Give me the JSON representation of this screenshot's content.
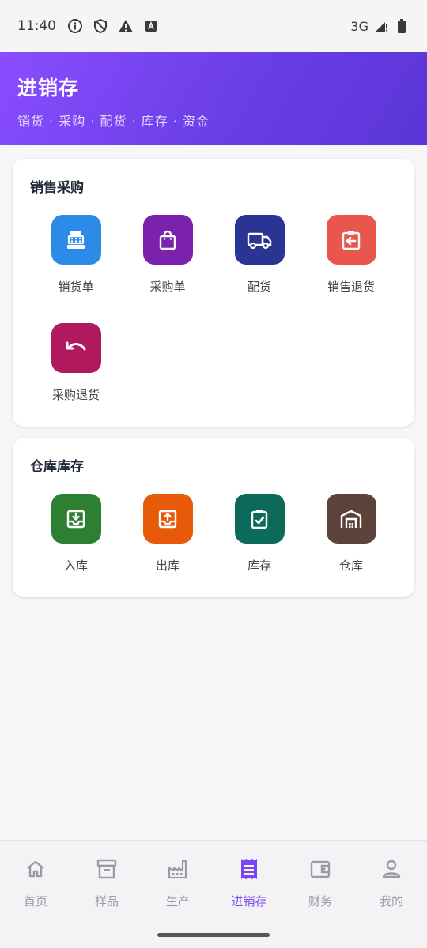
{
  "status_bar": {
    "time": "11:40",
    "network": "3G",
    "icons": [
      "info-icon",
      "shield-icon",
      "warning-icon",
      "font-icon",
      "signal-icon",
      "battery-icon"
    ]
  },
  "header": {
    "title": "进销存",
    "subtitle": "销货 · 采购 · 配货 · 库存 · 资金"
  },
  "sections": [
    {
      "title": "销售采购",
      "items": [
        {
          "label": "销货单",
          "icon": "cash-register-icon",
          "color": "#2b8be6"
        },
        {
          "label": "采购单",
          "icon": "shopping-bag-icon",
          "color": "#7b22ad"
        },
        {
          "label": "配货",
          "icon": "truck-icon",
          "color": "#2a3493"
        },
        {
          "label": "销售退货",
          "icon": "return-box-icon",
          "color": "#e9564c"
        },
        {
          "label": "采购退货",
          "icon": "undo-icon",
          "color": "#b0195e"
        }
      ]
    },
    {
      "title": "仓库库存",
      "items": [
        {
          "label": "入库",
          "icon": "inbox-in-icon",
          "color": "#2f7f33"
        },
        {
          "label": "出库",
          "icon": "inbox-out-icon",
          "color": "#e65a0a"
        },
        {
          "label": "库存",
          "icon": "clipboard-check-icon",
          "color": "#0b6a5a"
        },
        {
          "label": "仓库",
          "icon": "warehouse-icon",
          "color": "#5c4238"
        }
      ]
    }
  ],
  "bottom_nav": {
    "items": [
      {
        "label": "首页",
        "icon": "home-icon"
      },
      {
        "label": "样品",
        "icon": "archive-icon"
      },
      {
        "label": "生产",
        "icon": "factory-icon"
      },
      {
        "label": "进销存",
        "icon": "receipt-icon",
        "active": true
      },
      {
        "label": "财务",
        "icon": "wallet-icon"
      },
      {
        "label": "我的",
        "icon": "person-icon"
      }
    ],
    "active_color": "#7a45f3"
  }
}
